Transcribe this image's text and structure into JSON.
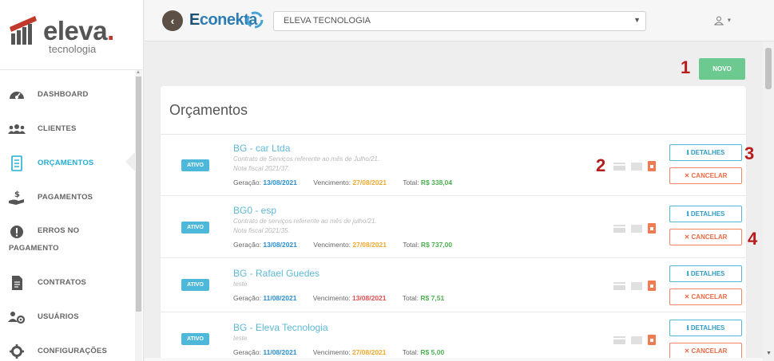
{
  "brand": {
    "name": "eleva",
    "dot": ".",
    "subtitle": "tecnologia"
  },
  "sidebar": {
    "items": [
      {
        "label": "DASHBOARD",
        "icon": "dashboard-gauge-icon"
      },
      {
        "label": "CLIENTES",
        "icon": "users-group-icon"
      },
      {
        "label": "ORÇAMENTOS",
        "icon": "document-list-icon",
        "active": true
      },
      {
        "label": "PAGAMENTOS",
        "icon": "hand-money-icon"
      },
      {
        "label": "ERROS NO PAGAMENTO",
        "icon": "exclamation-circle-icon"
      },
      {
        "label": "CONTRATOS",
        "icon": "contract-document-icon"
      },
      {
        "label": "USUÁRIOS",
        "icon": "user-gear-icon"
      },
      {
        "label": "CONFIGURAÇÕES",
        "icon": "gear-icon"
      }
    ]
  },
  "topbar": {
    "app_name_prefix": "E",
    "app_name_rest": "conekta",
    "company_select": "ELEVA TECNOLOGIA",
    "user_icon": "user-icon"
  },
  "actions": {
    "new_label": "NOVO"
  },
  "markers": [
    "1",
    "2",
    "3",
    "4"
  ],
  "card": {
    "title": "Orçamentos",
    "rows": [
      {
        "status": "ATIVO",
        "title": "BG      -             car Ltda",
        "desc1": "Contrato de Serviços referente ao mês de Julho/21.",
        "desc2": "Nota fiscal 2021/37.",
        "gen_label": "Geração:",
        "gen_date": "13/08/2021",
        "due_label": "Vencimento:",
        "due_date": "27/08/2021",
        "total_label": "Total:",
        "total": "R$ 338,04",
        "details": "ℹ DETALHES",
        "cancel": "✕ CANCELAR"
      },
      {
        "status": "ATIVO",
        "title": "BG0      -        esp",
        "desc1": "Contrato de serviços referente ao mês de julho/21.",
        "desc2": "Nota fiscal 2021/35.",
        "gen_label": "Geração:",
        "gen_date": "13/08/2021",
        "due_label": "Vencimento:",
        "due_date": "27/08/2021",
        "total_label": "Total:",
        "total": "R$ 737,00",
        "details": "ℹ DETALHES",
        "cancel": "✕ CANCELAR"
      },
      {
        "status": "ATIVO",
        "title": "BG      - Rafael Guedes",
        "desc1": "teste",
        "gen_label": "Geração:",
        "gen_date": "11/08/2021",
        "due_label": "Vencimento:",
        "due_date": "13/08/2021",
        "total_label": "Total:",
        "total": "R$ 7,51",
        "details": "ℹ DETALHES",
        "cancel": "✕ CANCELAR"
      },
      {
        "status": "ATIVO",
        "title": "BG      - Eleva Tecnologia",
        "desc1": "teste",
        "gen_label": "Geração:",
        "gen_date": "11/08/2021",
        "due_label": "Vencimento:",
        "due_date": "27/08/2021",
        "total_label": "Total:",
        "total": "R$ 5,00",
        "details": "ℹ DETALHES",
        "cancel": "✕ CANCELAR"
      }
    ]
  },
  "colors": {
    "accent": "#22aed3",
    "new_button": "#6cc990",
    "cancel": "#e86a44",
    "marker": "#b71c1c"
  }
}
